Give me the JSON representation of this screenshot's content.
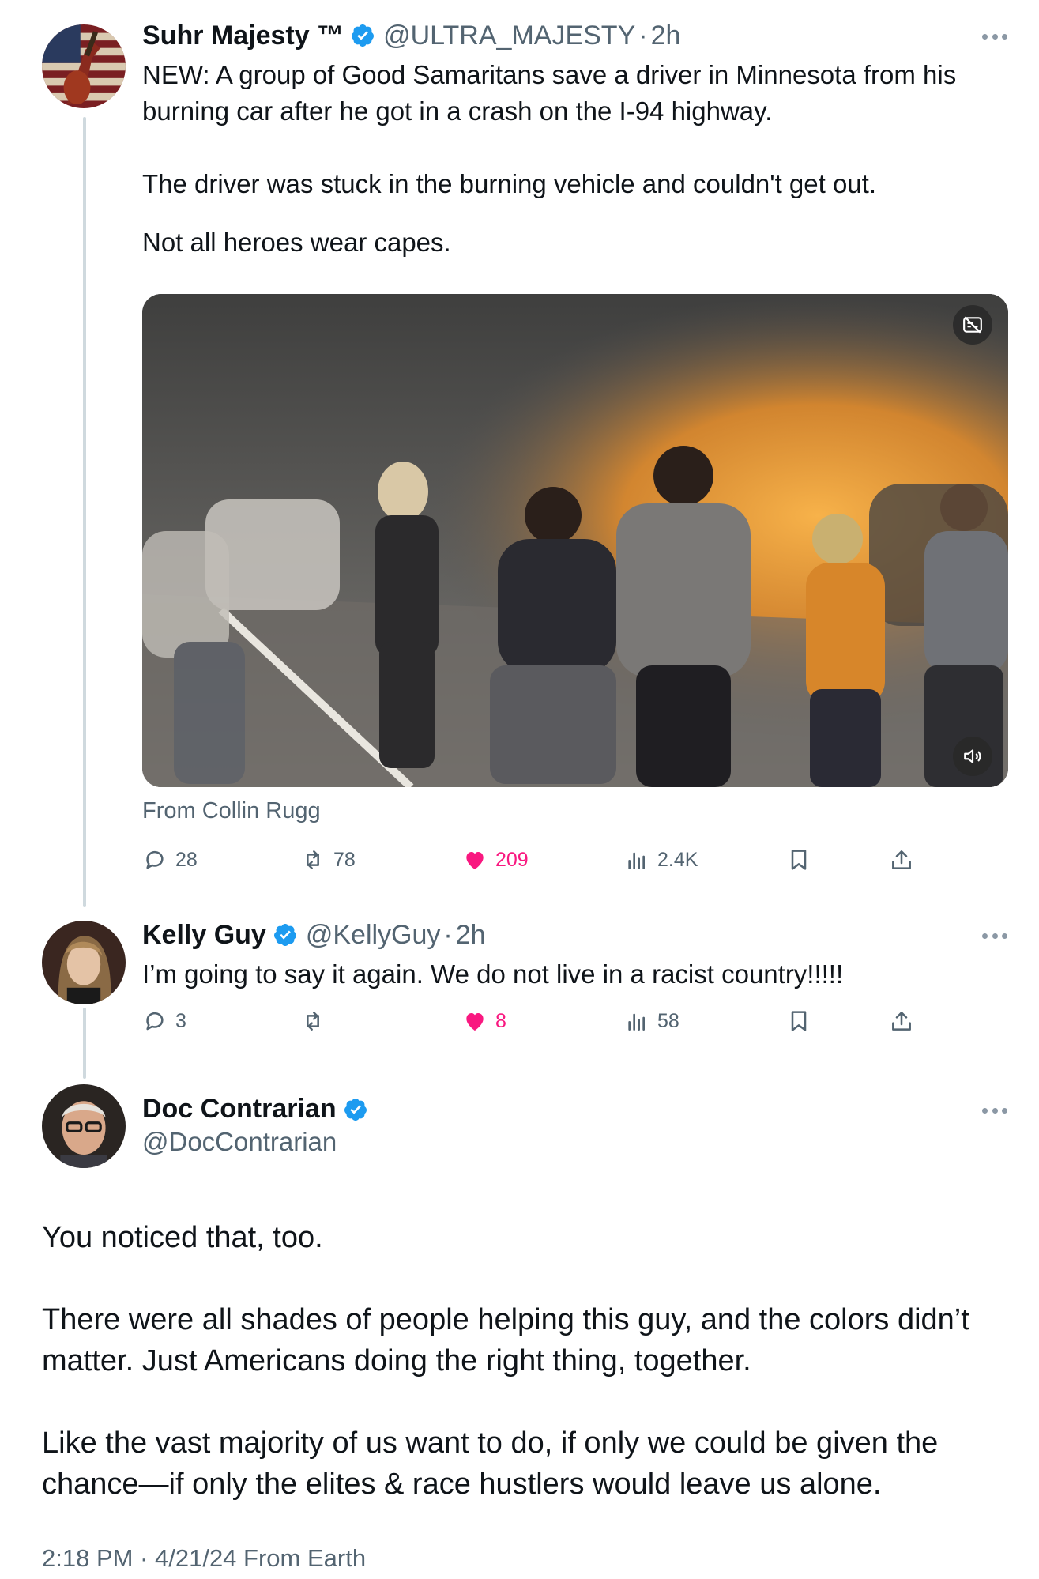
{
  "tweet1": {
    "name": "Suhr Majesty ™",
    "handle": "@ULTRA_MAJESTY",
    "time": "2h",
    "paragraphs": [
      "NEW: A group of Good Samaritans save a driver in Minnesota from his burning car after he got in a crash on the I-94 highway.",
      "The driver was stuck in the burning vehicle and couldn't get out.",
      "Not all heroes wear capes."
    ],
    "from": "From Collin Rugg",
    "replies": "28",
    "reposts": "78",
    "likes": "209",
    "views": "2.4K"
  },
  "tweet2": {
    "name": "Kelly Guy",
    "handle": "@KellyGuy",
    "time": "2h",
    "text": "I’m going to say it again. We do not live in a racist country!!!!!",
    "replies": "3",
    "reposts": "",
    "likes": "8",
    "views": "58"
  },
  "tweet3": {
    "name": "Doc Contrarian",
    "handle": "@DocContrarian",
    "paragraphs": [
      "You noticed that, too.",
      "There were all shades of people helping this guy, and the colors didn’t matter. Just Americans doing the right thing, together.",
      "Like the vast majority of us want to do, if only we could be given the chance—if only the elites & race hustlers would leave us alone."
    ],
    "meta": "2:18 PM · 4/21/24 From Earth"
  },
  "colors": {
    "verified": "#1d9bf0",
    "like": "#f91880",
    "secondary_text": "#536471",
    "thread_line": "#cfd9de"
  },
  "icons": [
    "reply-icon",
    "repost-icon",
    "heart-icon",
    "views-icon",
    "bookmark-icon",
    "share-icon",
    "verified-badge-icon",
    "more-icon",
    "mute-icon",
    "captions-icon"
  ]
}
